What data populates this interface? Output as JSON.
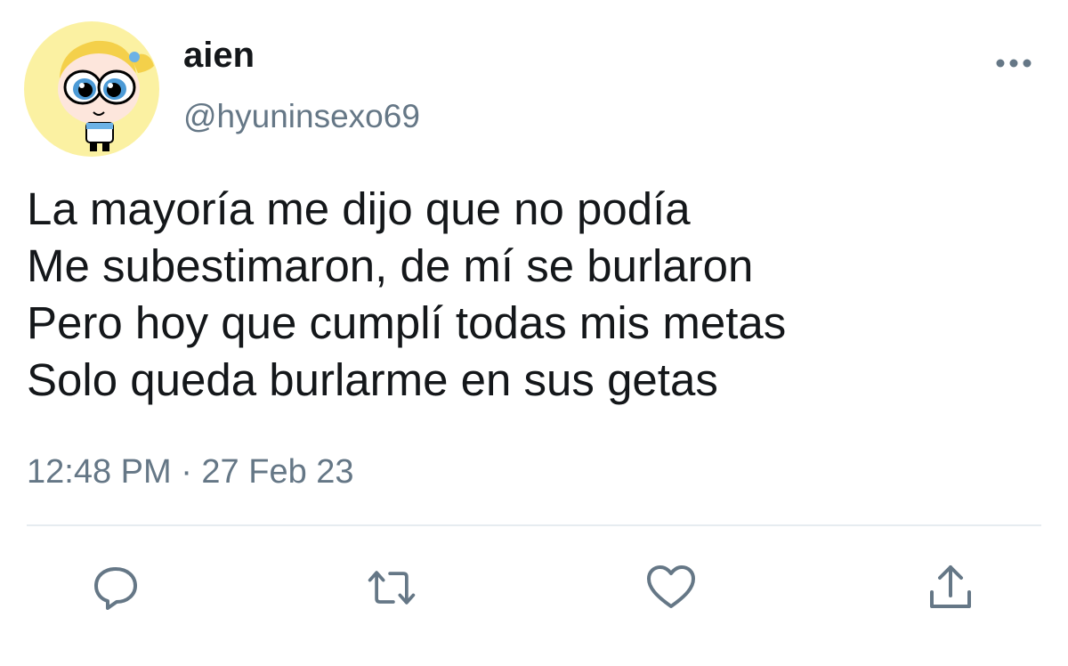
{
  "tweet": {
    "display_name": "aien",
    "handle": "@hyuninsexo69",
    "text_lines": [
      "La mayoría me dijo que no podía",
      "Me subestimaron, de mí se burlaron",
      "Pero hoy que cumplí todas mis metas",
      "Solo queda burlarme en sus getas"
    ],
    "timestamp": "12:48 PM · 27 Feb 23"
  },
  "icons": {
    "more": "more-horizontal-icon",
    "reply": "reply-icon",
    "retweet": "retweet-icon",
    "like": "heart-icon",
    "share": "share-icon"
  },
  "colors": {
    "text_primary": "#14171a",
    "text_secondary": "#657786",
    "icon": "#657786",
    "divider": "#e6ecf0",
    "avatar_bg": "#fbf1a2"
  }
}
